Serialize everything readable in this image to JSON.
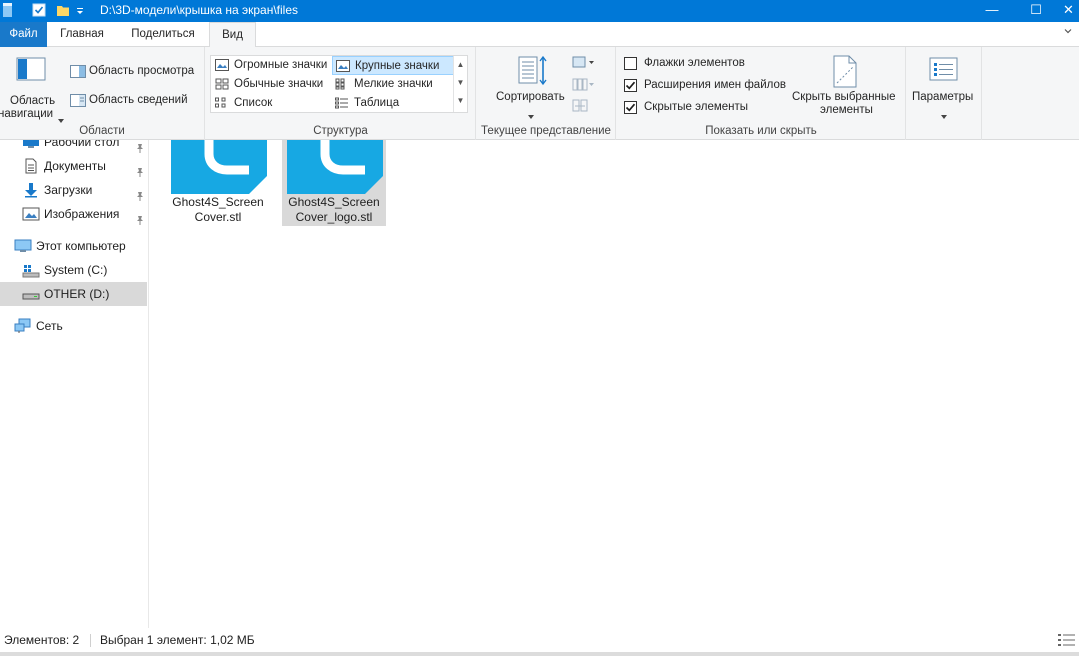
{
  "window": {
    "title": "D:\\3D-модели\\крышка на экран\\files",
    "minimize_glyph": "—",
    "maximize_glyph": "☐",
    "close_glyph": "✕",
    "accent_color": "#0078d7"
  },
  "tabs": [
    {
      "label": "Файл",
      "active": false
    },
    {
      "label": "Главная",
      "active": false
    },
    {
      "label": "Поделиться",
      "active": false
    },
    {
      "label": "Вид",
      "active": true
    }
  ],
  "ribbon": {
    "areas": {
      "nav_pane_label_1": "Область",
      "nav_pane_label_2": "навигации",
      "preview_pane": "Область просмотра",
      "details_pane": "Область сведений",
      "group_label": "Области"
    },
    "layout": {
      "options": [
        {
          "label": "Огромные значки",
          "icon": "extra-large-icons-icon"
        },
        {
          "label": "Крупные значки",
          "icon": "large-icons-icon",
          "selected": true
        },
        {
          "label": "Обычные значки",
          "icon": "medium-icons-icon"
        },
        {
          "label": "Мелкие значки",
          "icon": "small-icons-icon"
        },
        {
          "label": "Список",
          "icon": "list-icon"
        },
        {
          "label": "Таблица",
          "icon": "details-icon"
        }
      ],
      "group_label": "Структура"
    },
    "current_view": {
      "sort_label": "Сортировать",
      "group_label": "Текущее представление"
    },
    "show_hide": {
      "item_checkboxes": {
        "label": "Флажки элементов",
        "checked": false
      },
      "file_extensions": {
        "label": "Расширения имен файлов",
        "checked": true
      },
      "hidden_items": {
        "label": "Скрытые элементы",
        "checked": true
      },
      "hide_selected_1": "Скрыть выбранные",
      "hide_selected_2": "элементы",
      "group_label": "Показать или скрыть"
    },
    "options": {
      "label": "Параметры"
    }
  },
  "navigation": {
    "quick_access": [
      {
        "label": "Рабочий стол",
        "icon": "desktop-icon",
        "pinned": true
      },
      {
        "label": "Документы",
        "icon": "documents-icon",
        "pinned": true
      },
      {
        "label": "Загрузки",
        "icon": "downloads-icon",
        "pinned": true
      },
      {
        "label": "Изображения",
        "icon": "pictures-icon",
        "pinned": true
      }
    ],
    "this_pc": {
      "label": "Этот компьютер",
      "icon": "this-pc-icon"
    },
    "drives": [
      {
        "label": "System (C:)",
        "icon": "system-drive-icon",
        "selected": false
      },
      {
        "label": "OTHER (D:)",
        "icon": "drive-icon",
        "selected": true
      }
    ],
    "network": {
      "label": "Сеть",
      "icon": "network-icon"
    }
  },
  "files": [
    {
      "name_line1": "Ghost4S_Screen",
      "name_line2": "Cover.stl",
      "selected": false,
      "icon": "stl-file-icon"
    },
    {
      "name_line1": "Ghost4S_Screen",
      "name_line2": "Cover_logo.stl",
      "selected": true,
      "icon": "stl-file-icon"
    }
  ],
  "status": {
    "item_count": "Элементов: 2",
    "selection": "Выбран 1 элемент: 1,02 МБ"
  }
}
